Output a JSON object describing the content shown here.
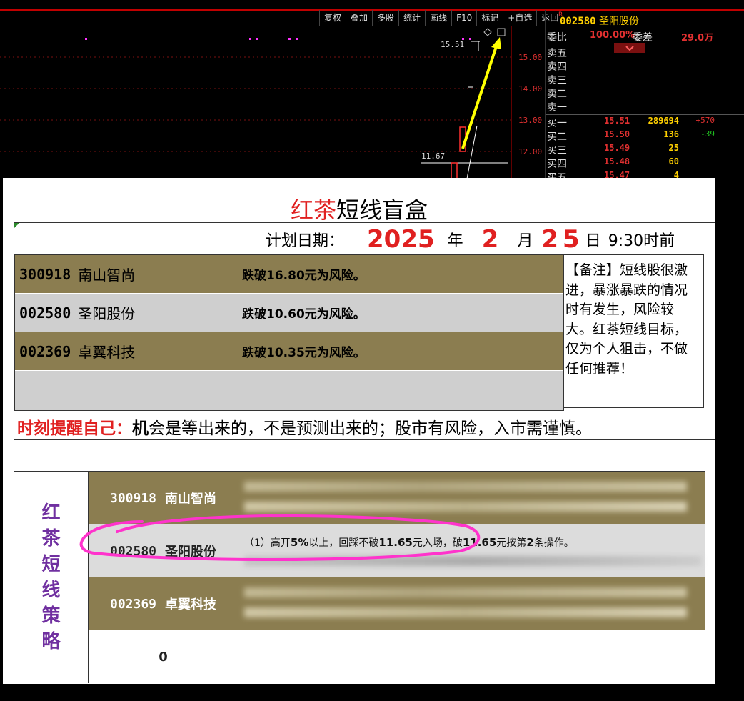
{
  "terminal": {
    "toolbar": [
      "复权",
      "叠加",
      "多股",
      "统计",
      "画线",
      "F10",
      "标记",
      "+自选",
      "返回"
    ],
    "chart": {
      "price_labels": [
        "15.00",
        "14.00",
        "13.00",
        "12.00"
      ],
      "high_label": "15.51",
      "low_label": "11.67"
    },
    "quote": {
      "marker": "R",
      "code": "002580",
      "name": "圣阳股份",
      "weibi_label": "委比",
      "weibi_value": "100.00%",
      "weicha_label": "委差",
      "weicha_value": "29.0万",
      "sell": [
        {
          "label": "卖五"
        },
        {
          "label": "卖四"
        },
        {
          "label": "卖三"
        },
        {
          "label": "卖二"
        },
        {
          "label": "卖一"
        }
      ],
      "buy": [
        {
          "label": "买一",
          "price": "15.51",
          "vol": "289694",
          "chg": "+570"
        },
        {
          "label": "买二",
          "price": "15.50",
          "vol": "136",
          "chg": "-39"
        },
        {
          "label": "买三",
          "price": "15.49",
          "vol": "25",
          "chg": ""
        },
        {
          "label": "买四",
          "price": "15.48",
          "vol": "60",
          "chg": ""
        },
        {
          "label": "买五",
          "price": "15.47",
          "vol": "4",
          "chg": ""
        }
      ],
      "colors": {
        "up": "#e03030",
        "down": "#20c020",
        "vol": "#ffd000"
      }
    }
  },
  "card": {
    "title_red": "红茶",
    "title_black": "短线盲盒",
    "date": {
      "label": "计划日期：",
      "year": "2025",
      "year_unit": "年",
      "month": "2",
      "month_unit": "月",
      "day": "25",
      "day_unit": "日",
      "time": "9:30时前"
    },
    "plans": [
      {
        "code": "300918",
        "name": "南山智尚",
        "risk": "跌破16.80元为风险。"
      },
      {
        "code": "002580",
        "name": "圣阳股份",
        "risk": "跌破10.60元为风险。"
      },
      {
        "code": "002369",
        "name": "卓翼科技",
        "risk": "跌破10.35元为风险。"
      }
    ],
    "note": "【备注】短线股很激进，暴涨暴跌的情况时有发生，风险较大。红茶短线目标，仅为个人狙击，不做任何推荐！",
    "reminder_red": "时刻提醒自己：",
    "reminder_bold": "机",
    "reminder_rest": "会是等出来的，不是预测出来的；股市有风险，入市需谨慎。",
    "strategy_label": [
      "红",
      "茶",
      "短",
      "线",
      "策",
      "略"
    ],
    "strategies": [
      {
        "code": "300918",
        "name": "南山智尚"
      },
      {
        "code": "002580",
        "name": "圣阳股份",
        "text_pre": "（1）高开",
        "t1": "5%",
        "text_mid1": "以上，回踩不破",
        "t2": "11.65",
        "text_mid2": "元入场，破",
        "t3": "11.65",
        "text_mid3": "元按第",
        "t4": "2",
        "text_end": "条操作。"
      },
      {
        "code": "002369",
        "name": "卓翼科技"
      },
      {
        "code": "",
        "name": "0"
      }
    ],
    "colors": {
      "gold": "#8b7d50",
      "red": "#e02020",
      "purple": "#7030a0",
      "highlight": "#ff33cc"
    }
  }
}
